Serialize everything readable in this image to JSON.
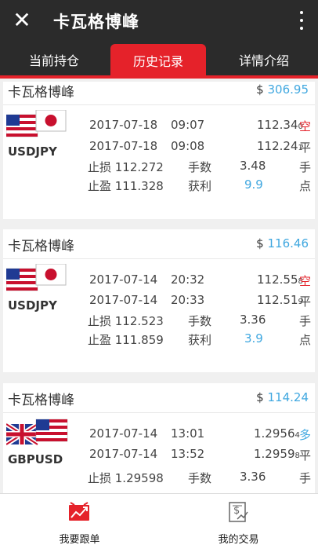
{
  "header": {
    "close_icon": "close-icon",
    "title": "卡瓦格博峰",
    "menu_icon": "more-vertical-icon"
  },
  "tabs": [
    {
      "label": "当前持仓"
    },
    {
      "label": "历史记录",
      "active": true
    },
    {
      "label": "详情介绍"
    }
  ],
  "cards": [
    {
      "name": "卡瓦格博峰",
      "currency": "$",
      "amount": "306.95",
      "pair": "USDJPY",
      "flags": [
        "us-flag-icon",
        "japan-flag-icon"
      ],
      "open_date": "2017-07-18",
      "open_time": "09:07",
      "open_price_main": "112.34",
      "open_price_sub": "0",
      "direction": "空",
      "close_date": "2017-07-18",
      "close_time": "09:08",
      "close_price_main": "112.24",
      "close_price_sub": "1",
      "close_label": "平",
      "stop_loss": "止损 112.272",
      "lots_label": "手数",
      "lots": "3.48",
      "lots_unit": "手",
      "take_profit": "止盈 111.328",
      "profit_label": "获利",
      "profit": "9.9",
      "profit_unit": "点"
    },
    {
      "name": "卡瓦格博峰",
      "currency": "$",
      "amount": "116.46",
      "pair": "USDJPY",
      "flags": [
        "us-flag-icon",
        "japan-flag-icon"
      ],
      "open_date": "2017-07-14",
      "open_time": "20:32",
      "open_price_main": "112.55",
      "open_price_sub": "8",
      "direction": "空",
      "close_date": "2017-07-14",
      "close_time": "20:33",
      "close_price_main": "112.51",
      "close_price_sub": "9",
      "close_label": "平",
      "stop_loss": "止损 112.523",
      "lots_label": "手数",
      "lots": "3.36",
      "lots_unit": "手",
      "take_profit": "止盈 111.859",
      "profit_label": "获利",
      "profit": "3.9",
      "profit_unit": "点"
    },
    {
      "name": "卡瓦格博峰",
      "currency": "$",
      "amount": "114.24",
      "pair": "GBPUSD",
      "flags": [
        "uk-flag-icon",
        "us-flag-icon"
      ],
      "open_date": "2017-07-14",
      "open_time": "13:01",
      "open_price_main": "1.2956",
      "open_price_sub": "4",
      "direction": "多",
      "close_date": "2017-07-14",
      "close_time": "13:52",
      "close_price_main": "1.2959",
      "close_price_sub": "8",
      "close_label": "平",
      "stop_loss": "止损 1.29598",
      "lots_label": "手数",
      "lots": "3.36",
      "lots_unit": "手"
    }
  ],
  "bottom_nav": [
    {
      "label": "我要跟单",
      "icon": "follow-trade-icon"
    },
    {
      "label": "我的交易",
      "icon": "my-trade-icon"
    }
  ],
  "colors": {
    "accent": "#e5222a",
    "value_blue": "#41a8e0",
    "header_bg": "#2b2b2b"
  }
}
